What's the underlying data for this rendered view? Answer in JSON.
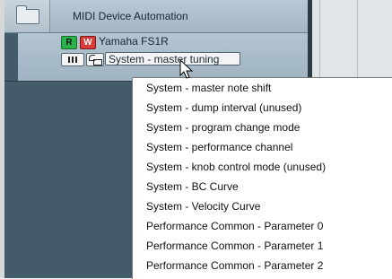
{
  "header": {
    "label": "MIDI Device Automation",
    "icon": "folder-icon"
  },
  "track": {
    "record_label": "R",
    "write_label": "W",
    "name": "Yamaha FS1R",
    "parameter_selected": "System - master tuning"
  },
  "menu": {
    "items": [
      "System - master note shift",
      "System - dump interval (unused)",
      "System - program change mode",
      "System - performance channel",
      "System - knob control mode (unused)",
      "System - BC Curve",
      "System - Velocity Curve",
      "Performance Common - Parameter 0",
      "Performance Common - Parameter 1",
      "Performance Common - Parameter 2"
    ]
  },
  "colors": {
    "record": "#2bb34a",
    "write": "#d93a3a",
    "panel": "#445b6a"
  }
}
